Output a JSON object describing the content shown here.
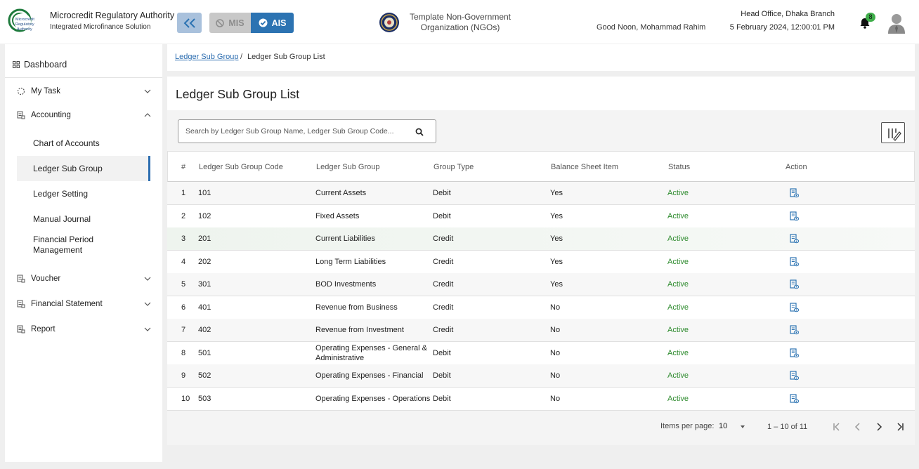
{
  "header": {
    "org_name": "Microcredit Regulatory Authority",
    "org_sub": "Integrated Microfinance Solution",
    "logo_text": "Microcredit Regulatory Authority",
    "mis_label": "MIS",
    "ais_label": "AIS",
    "ngo_name": "Template Non-Government Organization (NGOs)",
    "greeting": "Good Noon, Mohammad Rahim",
    "branch": "Head Office, Dhaka Branch",
    "datetime": "5 February 2024, 12:00:01 PM",
    "notification_count": "8",
    "colors": {
      "accent": "#2c73b2",
      "collapse_bg": "#a9c1dc",
      "badge": "#3fae4a"
    }
  },
  "sidebar": {
    "dashboard": "Dashboard",
    "items": [
      {
        "label": "My Task",
        "icon": "loader-icon",
        "expanded": false
      },
      {
        "label": "Accounting",
        "icon": "ledger-icon",
        "expanded": true
      },
      {
        "label": "Voucher",
        "icon": "ledger-icon",
        "expanded": false
      },
      {
        "label": "Financial Statement",
        "icon": "ledger-icon",
        "expanded": false
      },
      {
        "label": "Report",
        "icon": "ledger-icon",
        "expanded": false
      }
    ],
    "accounting_sub": [
      {
        "label": "Chart of Accounts"
      },
      {
        "label": "Ledger Sub Group",
        "active": true
      },
      {
        "label": "Ledger Setting"
      },
      {
        "label": "Manual Journal"
      },
      {
        "label": "Financial Period Management"
      }
    ]
  },
  "breadcrumb": {
    "parent": "Ledger Sub Group",
    "separator": "/",
    "current": "Ledger Sub Group List"
  },
  "main": {
    "title": "Ledger Sub Group List",
    "search_placeholder": "Search by Ledger Sub Group Name, Ledger Sub Group Code..."
  },
  "table": {
    "columns": [
      "#",
      "Ledger Sub Group Code",
      "Ledger Sub Group",
      "Group Type",
      "Balance Sheet Item",
      "Status",
      "Action"
    ],
    "rows": [
      {
        "n": "1",
        "code": "101",
        "name": "Current Assets",
        "type": "Debit",
        "bs": "Yes",
        "status": "Active"
      },
      {
        "n": "2",
        "code": "102",
        "name": "Fixed Assets",
        "type": "Debit",
        "bs": "Yes",
        "status": "Active"
      },
      {
        "n": "3",
        "code": "201",
        "name": "Current Liabilities",
        "type": "Credit",
        "bs": "Yes",
        "status": "Active"
      },
      {
        "n": "4",
        "code": "202",
        "name": "Long Term Liabilities",
        "type": "Credit",
        "bs": "Yes",
        "status": "Active"
      },
      {
        "n": "5",
        "code": "301",
        "name": "BOD Investments",
        "type": "Credit",
        "bs": "Yes",
        "status": "Active"
      },
      {
        "n": "6",
        "code": "401",
        "name": "Revenue from Business",
        "type": "Credit",
        "bs": "No",
        "status": "Active"
      },
      {
        "n": "7",
        "code": "402",
        "name": "Revenue from Investment",
        "type": "Credit",
        "bs": "No",
        "status": "Active"
      },
      {
        "n": "8",
        "code": "501",
        "name": "Operating Expenses - General & Administrative",
        "type": "Debit",
        "bs": "No",
        "status": "Active"
      },
      {
        "n": "9",
        "code": "502",
        "name": "Operating Expenses - Financial",
        "type": "Debit",
        "bs": "No",
        "status": "Active"
      },
      {
        "n": "10",
        "code": "503",
        "name": "Operating Expenses - Operations",
        "type": "Debit",
        "bs": "No",
        "status": "Active"
      }
    ]
  },
  "paginator": {
    "items_per_page_label": "Items per page:",
    "items_per_page": "10",
    "range": "1 – 10 of 11"
  }
}
